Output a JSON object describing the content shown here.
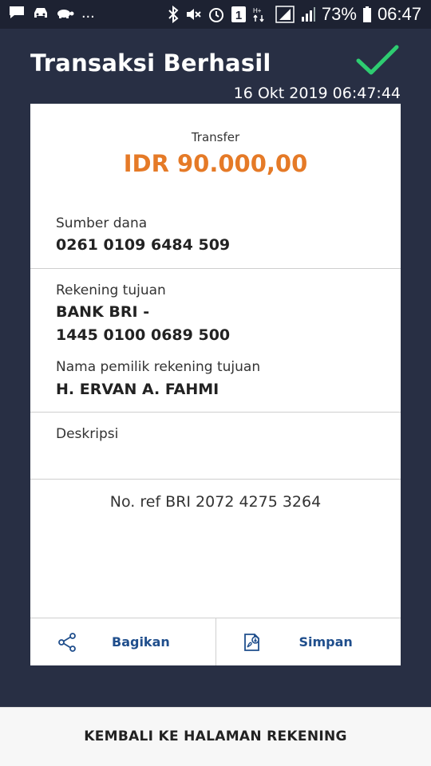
{
  "status_bar": {
    "notification_icons": [
      "chat-icon",
      "car-icon",
      "turtle-icon"
    ],
    "more": "...",
    "system_icons": [
      "bluetooth-icon",
      "mute-icon",
      "alarm-icon",
      "sim-1-icon",
      "ht-data-icon",
      "signal-icon",
      "signal-icon"
    ],
    "battery_percent": "73%",
    "time": "06:47"
  },
  "header": {
    "title": "Transaksi Berhasil",
    "datetime": "16 Okt 2019 06:47:44",
    "check_color": "#2ecc71"
  },
  "receipt": {
    "type": "Transfer",
    "amount": "IDR 90.000,00",
    "amount_color": "#e57a27",
    "source_label": "Sumber dana",
    "source_value": "0261 0109 6484 509",
    "dest_label": "Rekening tujuan",
    "dest_bank": "BANK BRI -",
    "dest_account": "1445 0100 0689 500",
    "owner_label": "Nama pemilik rekening tujuan",
    "owner_value": "H. ERVAN A. FAHMI",
    "desc_label": "Deskripsi",
    "desc_value": "",
    "ref": "No. ref BRI 2072 4275 3264"
  },
  "actions": {
    "share_label": "Bagikan",
    "save_label": "Simpan",
    "link_color": "#1f4e8c"
  },
  "footer": {
    "back_label": "KEMBALI KE HALAMAN REKENING"
  }
}
